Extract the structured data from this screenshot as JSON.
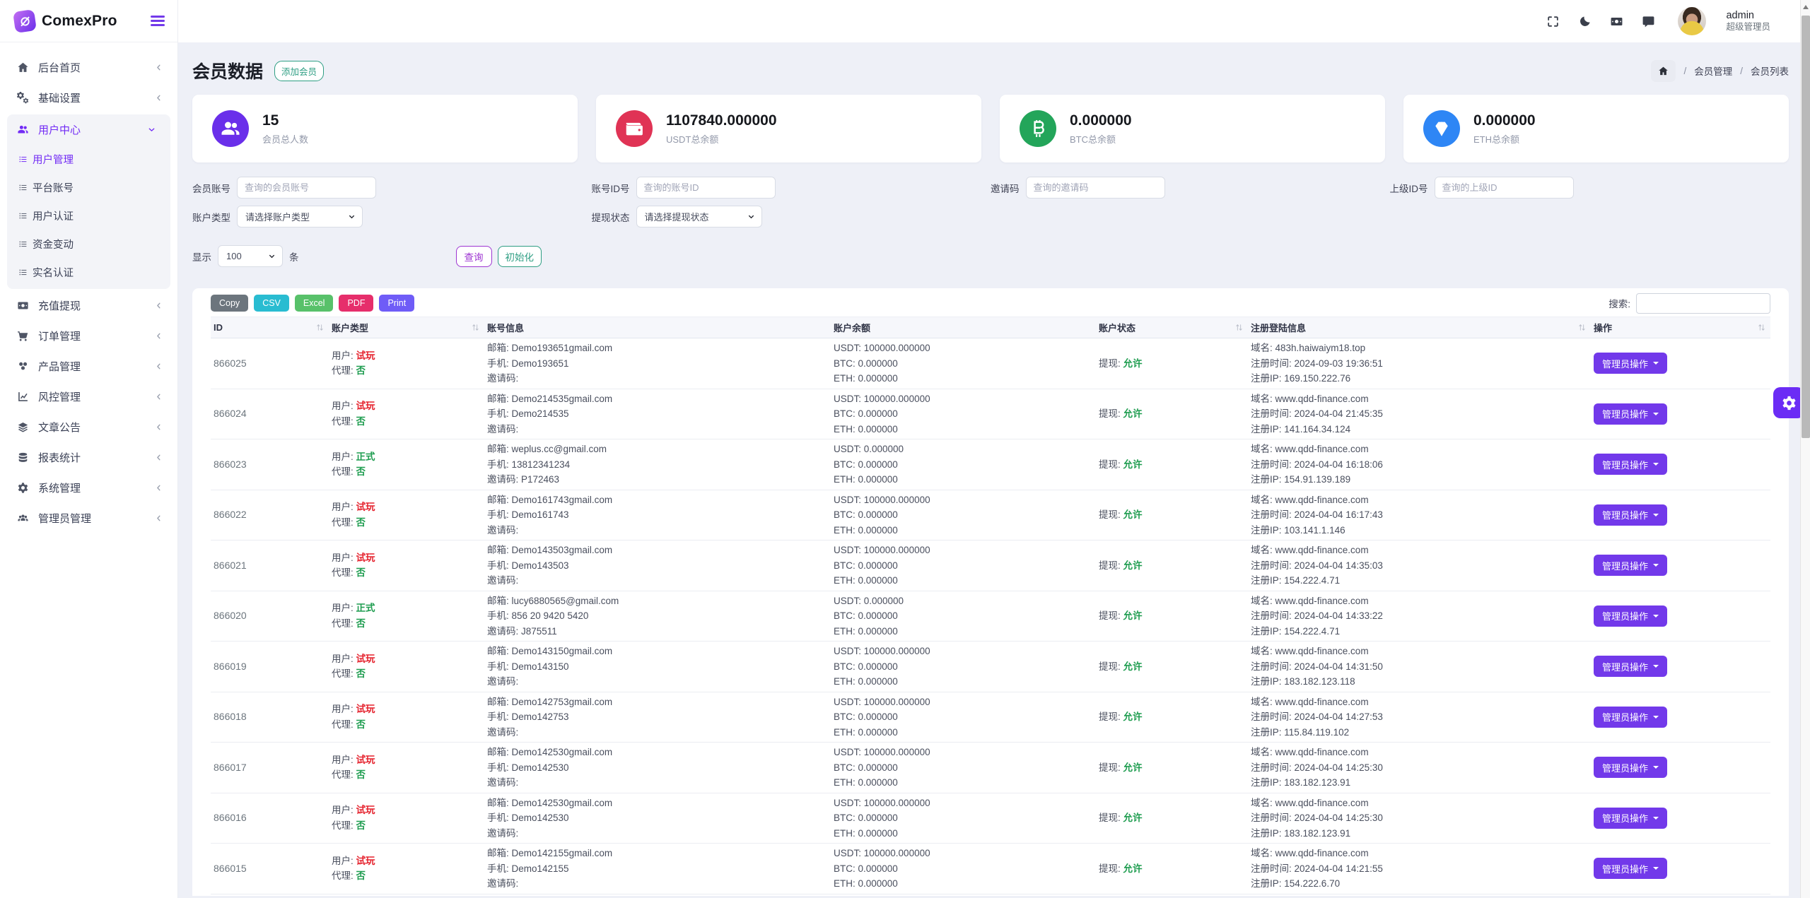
{
  "sidebar": {
    "logo_text": "ComexPro",
    "menu": [
      {
        "key": "home-page",
        "label": "后台首页",
        "icon": "home",
        "children": null
      },
      {
        "key": "basic-settings",
        "label": "基础设置",
        "icon": "gears",
        "children": null
      },
      {
        "key": "user-center",
        "label": "用户中心",
        "icon": "users",
        "active": true,
        "children": [
          {
            "key": "user-management",
            "label": "用户管理",
            "active": true
          },
          {
            "key": "platform-account",
            "label": "平台账号"
          },
          {
            "key": "user-auth",
            "label": "用户认证"
          },
          {
            "key": "funds-change",
            "label": "资金变动"
          },
          {
            "key": "realname-auth",
            "label": "实名认证"
          }
        ]
      },
      {
        "key": "recharge-withdraw",
        "label": "充值提现",
        "icon": "banknote",
        "children": null
      },
      {
        "key": "order-management",
        "label": "订单管理",
        "icon": "cart",
        "children": null
      },
      {
        "key": "product-management",
        "label": "产品管理",
        "icon": "product",
        "children": null
      },
      {
        "key": "risk-management",
        "label": "风控管理",
        "icon": "chart",
        "children": null
      },
      {
        "key": "article-announcement",
        "label": "文章公告",
        "icon": "layers",
        "children": null
      },
      {
        "key": "report-statistics",
        "label": "报表统计",
        "icon": "report",
        "children": null
      },
      {
        "key": "system-management",
        "label": "系统管理",
        "icon": "gear",
        "children": null
      },
      {
        "key": "admin-management",
        "label": "管理员管理",
        "icon": "admins",
        "children": null
      }
    ]
  },
  "header": {
    "user_name": "admin",
    "user_role": "超级管理员"
  },
  "page": {
    "title": "会员数据",
    "add_member": "添加会员",
    "breadcrumb": {
      "section": "会员管理",
      "current": "会员列表"
    }
  },
  "stats": [
    {
      "value": "15",
      "label": "会员总人数",
      "icon": "members",
      "color": "#6a2fea"
    },
    {
      "value": "1107840.000000",
      "label": "USDT总余额",
      "icon": "wallet",
      "color": "#e03355"
    },
    {
      "value": "0.000000",
      "label": "BTC总余额",
      "icon": "btc",
      "color": "#23a55a"
    },
    {
      "value": "0.000000",
      "label": "ETH总余额",
      "icon": "eth",
      "color": "#2e86f5"
    }
  ],
  "filters": {
    "fields_row1": [
      {
        "key": "member-account",
        "label": "会员账号",
        "placeholder": "查询的会员账号"
      },
      {
        "key": "account-id",
        "label": "账号ID号",
        "placeholder": "查询的账号ID"
      },
      {
        "key": "invite-code",
        "label": "邀请码",
        "placeholder": "查询的邀请码"
      },
      {
        "key": "parent-id",
        "label": "上级ID号",
        "placeholder": "查询的上级ID"
      }
    ],
    "fields_row2": [
      {
        "key": "account-type",
        "label": "账户类型",
        "value": "请选择账户类型"
      },
      {
        "key": "withdraw-status",
        "label": "提现状态",
        "value": "请选择提现状态"
      }
    ],
    "show_label": "显示",
    "show_value": "100",
    "show_unit": "条",
    "query_button": "查询",
    "reset_button": "初始化"
  },
  "table": {
    "export_buttons": [
      {
        "label": "Copy",
        "color": "#6c757d"
      },
      {
        "label": "CSV",
        "color": "#29bcd1"
      },
      {
        "label": "Excel",
        "color": "#58c16a"
      },
      {
        "label": "PDF",
        "color": "#e62e6b"
      },
      {
        "label": "Print",
        "color": "#6f5cf7"
      }
    ],
    "search_label": "搜索:",
    "columns": [
      {
        "label": "ID",
        "sort": true
      },
      {
        "label": "账户类型",
        "sort": true
      },
      {
        "label": "账号信息",
        "sort": false
      },
      {
        "label": "账户余额",
        "sort": false
      },
      {
        "label": "账户状态",
        "sort": true
      },
      {
        "label": "注册登陆信息",
        "sort": true
      },
      {
        "label": "操作",
        "sort": true
      }
    ],
    "row_labels": {
      "user": "用户:",
      "agent": "代理:",
      "email": "邮箱:",
      "phone": "手机:",
      "invite": "邀请码:",
      "usdt": "USDT:",
      "btc": "BTC:",
      "eth": "ETH:",
      "withdraw": "提现:",
      "domain": "域名:",
      "reg_time": "注册时间:",
      "reg_ip": "注册IP:",
      "action": "管理员操作"
    },
    "rows": [
      {
        "id": "866025",
        "user_type": "试玩",
        "trial": true,
        "agent": "否",
        "email": "Demo193651gmail.com",
        "phone": "Demo193651",
        "invite": "",
        "usdt": "100000.000000",
        "btc": "0.000000",
        "eth": "0.000000",
        "withdraw": "允许",
        "domain": "483h.haiwaiym18.top",
        "reg_time": "2024-09-03 19:36:51",
        "reg_ip": "169.150.222.76"
      },
      {
        "id": "866024",
        "user_type": "试玩",
        "trial": true,
        "agent": "否",
        "email": "Demo214535gmail.com",
        "phone": "Demo214535",
        "invite": "",
        "usdt": "100000.000000",
        "btc": "0.000000",
        "eth": "0.000000",
        "withdraw": "允许",
        "domain": "www.qdd-finance.com",
        "reg_time": "2024-04-04 21:45:35",
        "reg_ip": "141.164.34.124"
      },
      {
        "id": "866023",
        "user_type": "正式",
        "trial": false,
        "agent": "否",
        "email": "weplus.cc@gmail.com",
        "phone": "13812341234",
        "invite": "P172463",
        "usdt": "0.000000",
        "btc": "0.000000",
        "eth": "0.000000",
        "withdraw": "允许",
        "domain": "www.qdd-finance.com",
        "reg_time": "2024-04-04 16:18:06",
        "reg_ip": "154.91.139.189"
      },
      {
        "id": "866022",
        "user_type": "试玩",
        "trial": true,
        "agent": "否",
        "email": "Demo161743gmail.com",
        "phone": "Demo161743",
        "invite": "",
        "usdt": "100000.000000",
        "btc": "0.000000",
        "eth": "0.000000",
        "withdraw": "允许",
        "domain": "www.qdd-finance.com",
        "reg_time": "2024-04-04 16:17:43",
        "reg_ip": "103.141.1.146"
      },
      {
        "id": "866021",
        "user_type": "试玩",
        "trial": true,
        "agent": "否",
        "email": "Demo143503gmail.com",
        "phone": "Demo143503",
        "invite": "",
        "usdt": "100000.000000",
        "btc": "0.000000",
        "eth": "0.000000",
        "withdraw": "允许",
        "domain": "www.qdd-finance.com",
        "reg_time": "2024-04-04 14:35:03",
        "reg_ip": "154.222.4.71"
      },
      {
        "id": "866020",
        "user_type": "正式",
        "trial": false,
        "agent": "否",
        "email": "lucy6880565@gmail.com",
        "phone": "856 20 9420 5420",
        "invite": "J875511",
        "usdt": "0.000000",
        "btc": "0.000000",
        "eth": "0.000000",
        "withdraw": "允许",
        "domain": "www.qdd-finance.com",
        "reg_time": "2024-04-04 14:33:22",
        "reg_ip": "154.222.4.71"
      },
      {
        "id": "866019",
        "user_type": "试玩",
        "trial": true,
        "agent": "否",
        "email": "Demo143150gmail.com",
        "phone": "Demo143150",
        "invite": "",
        "usdt": "100000.000000",
        "btc": "0.000000",
        "eth": "0.000000",
        "withdraw": "允许",
        "domain": "www.qdd-finance.com",
        "reg_time": "2024-04-04 14:31:50",
        "reg_ip": "183.182.123.118"
      },
      {
        "id": "866018",
        "user_type": "试玩",
        "trial": true,
        "agent": "否",
        "email": "Demo142753gmail.com",
        "phone": "Demo142753",
        "invite": "",
        "usdt": "100000.000000",
        "btc": "0.000000",
        "eth": "0.000000",
        "withdraw": "允许",
        "domain": "www.qdd-finance.com",
        "reg_time": "2024-04-04 14:27:53",
        "reg_ip": "115.84.119.102"
      },
      {
        "id": "866017",
        "user_type": "试玩",
        "trial": true,
        "agent": "否",
        "email": "Demo142530gmail.com",
        "phone": "Demo142530",
        "invite": "",
        "usdt": "100000.000000",
        "btc": "0.000000",
        "eth": "0.000000",
        "withdraw": "允许",
        "domain": "www.qdd-finance.com",
        "reg_time": "2024-04-04 14:25:30",
        "reg_ip": "183.182.123.91"
      },
      {
        "id": "866016",
        "user_type": "试玩",
        "trial": true,
        "agent": "否",
        "email": "Demo142530gmail.com",
        "phone": "Demo142530",
        "invite": "",
        "usdt": "100000.000000",
        "btc": "0.000000",
        "eth": "0.000000",
        "withdraw": "允许",
        "domain": "www.qdd-finance.com",
        "reg_time": "2024-04-04 14:25:30",
        "reg_ip": "183.182.123.91"
      },
      {
        "id": "866015",
        "user_type": "试玩",
        "trial": true,
        "agent": "否",
        "email": "Demo142155gmail.com",
        "phone": "Demo142155",
        "invite": "",
        "usdt": "100000.000000",
        "btc": "0.000000",
        "eth": "0.000000",
        "withdraw": "允许",
        "domain": "www.qdd-finance.com",
        "reg_time": "2024-04-04 14:21:55",
        "reg_ip": "154.222.6.70"
      }
    ]
  }
}
